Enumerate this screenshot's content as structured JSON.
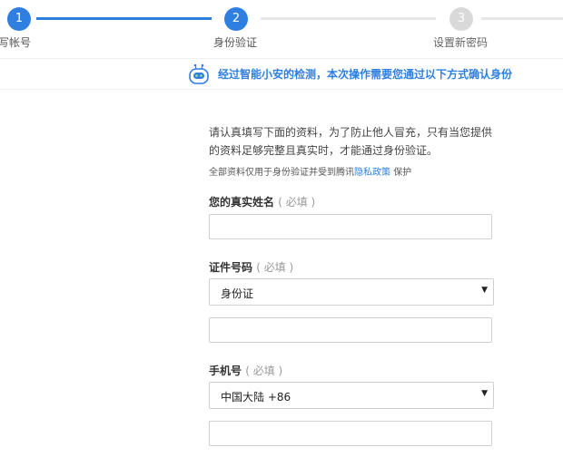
{
  "steps": [
    {
      "number": "1",
      "label": "填写帐号",
      "state": "done"
    },
    {
      "number": "2",
      "label": "身份验证",
      "state": "current"
    },
    {
      "number": "3",
      "label": "设置新密码",
      "state": "pending"
    }
  ],
  "notice": {
    "text": "经过智能小安的检测，本次操作需要您通过以下方式确认身份",
    "icon": "robot-assistant-icon",
    "color": "#2f7fe0"
  },
  "intro": {
    "text": "请认真填写下面的资料，为了防止他人冒充，只有当您提供的资料足够完整且真实时，才能通过身份验证。",
    "privacy_prefix": "全部资料仅用于身份验证并受到腾讯",
    "privacy_link": "隐私政策",
    "privacy_suffix": "保护"
  },
  "form": {
    "name": {
      "label": "您的真实姓名",
      "required_hint": "( 必填 )",
      "value": ""
    },
    "id_number": {
      "label": "证件号码",
      "required_hint": "( 必填 )",
      "type_value": "身份证",
      "value": ""
    },
    "phone": {
      "label": "手机号",
      "required_hint": "( 必填 )",
      "region_value": "中国大陆 +86",
      "value": ""
    }
  },
  "colors": {
    "accent": "#2f7fe0",
    "inactive": "#d9d9d9"
  }
}
